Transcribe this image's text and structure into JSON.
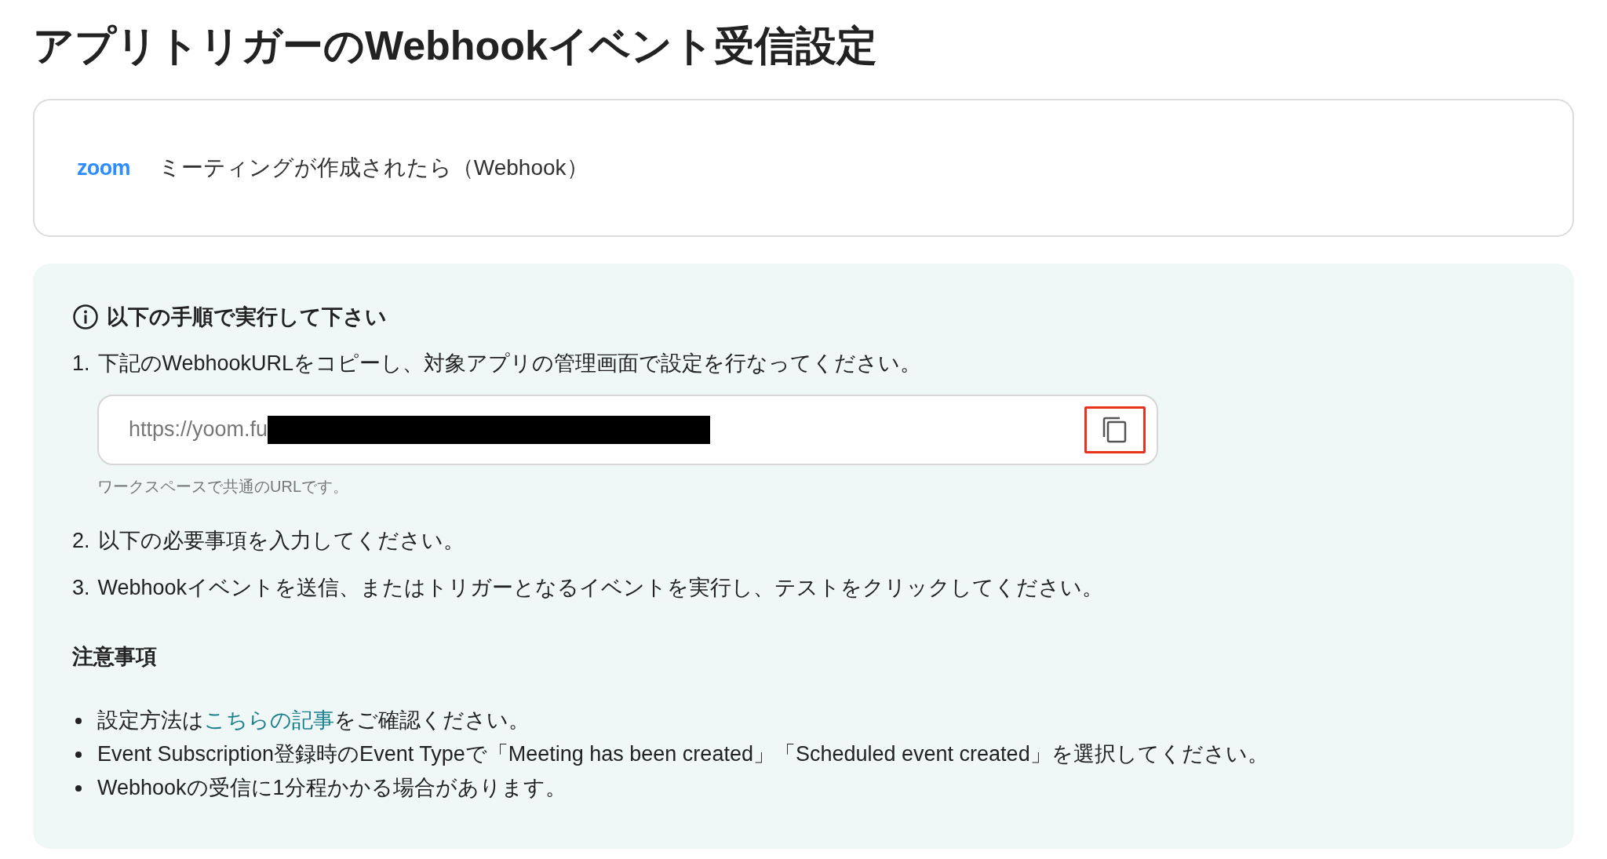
{
  "page_title": "アプリトリガーのWebhookイベント受信設定",
  "trigger": {
    "app_logo": "zoom",
    "label": "ミーティングが作成されたら（Webhook）"
  },
  "instructions": {
    "heading": "以下の手順で実行して下さい",
    "steps": [
      {
        "number": "1.",
        "text": "下記のWebhookURLをコピーし、対象アプリの管理画面で設定を行なってください。",
        "url_field": {
          "value": "https://yoom.fu",
          "redacted": true,
          "hint": "ワークスペースで共通のURLです。",
          "copy_highlighted": true
        }
      },
      {
        "number": "2.",
        "text": "以下の必要事項を入力してください。"
      },
      {
        "number": "3.",
        "text": "Webhookイベントを送信、またはトリガーとなるイベントを実行し、テストをクリックしてください。"
      }
    ],
    "notes_heading": "注意事項",
    "notes": [
      {
        "before": "設定方法は",
        "link": "こちらの記事",
        "after": "をご確認ください。"
      },
      {
        "before": "Event Subscription登録時のEvent Typeで「Meeting has been created」「Scheduled event created」を選択してください。"
      },
      {
        "before": "Webhookの受信に1分程かかる場合があります。"
      }
    ]
  }
}
